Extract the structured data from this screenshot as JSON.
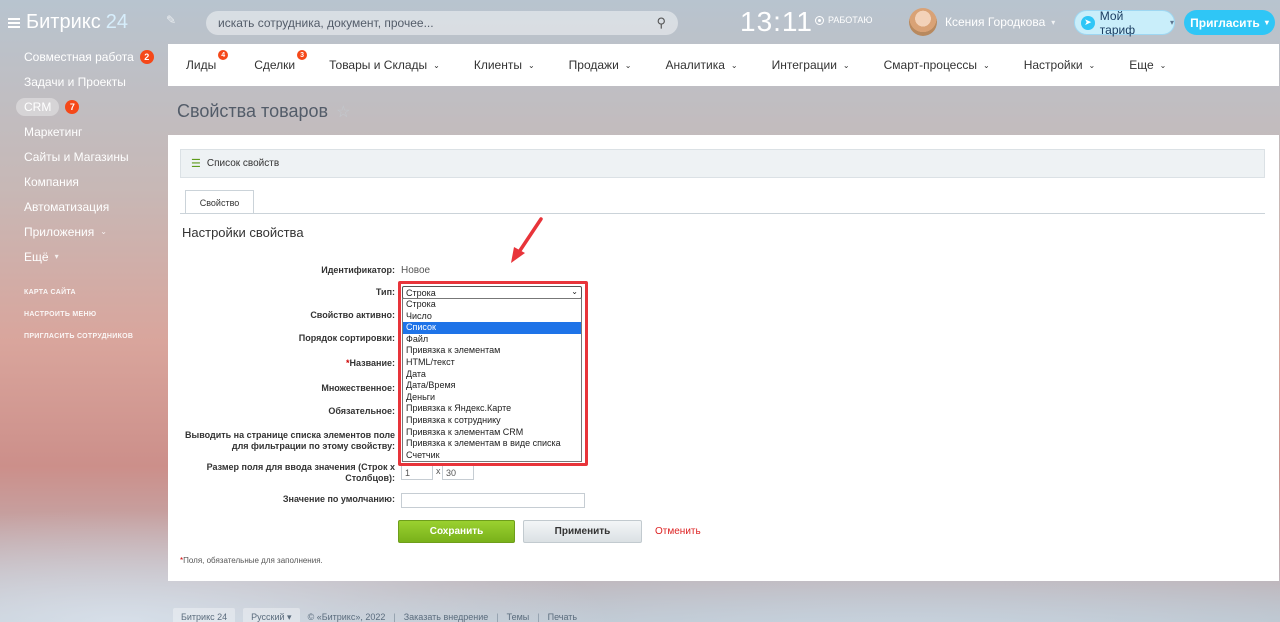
{
  "header": {
    "brand": "Битрикс",
    "brand_num": "24",
    "search_placeholder": "искать сотрудника, документ, прочее...",
    "clock": "13:11",
    "status": "РАБОТАЮ",
    "user_name": "Ксения Городкова",
    "tariff_label": "Мой тариф",
    "invite_label": "Пригласить"
  },
  "sidebar": {
    "items": [
      {
        "label": "Совместная работа",
        "counter": "2"
      },
      {
        "label": "Задачи и Проекты"
      },
      {
        "label": "CRM",
        "counter": "7"
      },
      {
        "label": "Маркетинг"
      },
      {
        "label": "Сайты и Магазины"
      },
      {
        "label": "Компания"
      },
      {
        "label": "Автоматизация"
      },
      {
        "label": "Приложения"
      },
      {
        "label": "Ещё"
      }
    ],
    "links": [
      "КАРТА САЙТА",
      "НАСТРОИТЬ МЕНЮ",
      "ПРИГЛАСИТЬ СОТРУДНИКОВ"
    ]
  },
  "topnav": {
    "items": [
      {
        "label": "Лиды",
        "counter": "4"
      },
      {
        "label": "Сделки",
        "counter": "3"
      },
      {
        "label": "Товары и Склады"
      },
      {
        "label": "Клиенты"
      },
      {
        "label": "Продажи"
      },
      {
        "label": "Аналитика"
      },
      {
        "label": "Интеграции"
      },
      {
        "label": "Смарт-процессы"
      },
      {
        "label": "Настройки"
      },
      {
        "label": "Еще"
      }
    ]
  },
  "page": {
    "title": "Свойства товаров",
    "list_link": "Список свойств",
    "tab": "Свойство",
    "section_title": "Настройки свойства"
  },
  "form": {
    "id_label": "Идентификатор:",
    "id_value": "Новое",
    "type_label": "Тип:",
    "type_selected": "Строка",
    "active_label": "Свойство активно:",
    "sort_label": "Порядок сортировки:",
    "name_label": "Название:",
    "multiple_label": "Множественное:",
    "required_label": "Обязательное:",
    "filter_label_1": "Выводить на странице списка элементов поле",
    "filter_label_2": "для фильтрации по этому свойству:",
    "size_label_1": "Размер поля для ввода значения (Строк х",
    "size_label_2": "Столбцов):",
    "size_rows": "1",
    "size_x": "x",
    "size_cols": "30",
    "default_label": "Значение по умолчанию:",
    "default_value": "",
    "type_options": [
      "Строка",
      "Число",
      "Список",
      "Файл",
      "Привязка к элементам",
      "HTML/текст",
      "Дата",
      "Дата/Время",
      "Деньги",
      "Привязка к Яндекс.Карте",
      "Привязка к сотруднику",
      "Привязка к элементам CRM",
      "Привязка к элементам в виде списка",
      "Счетчик"
    ],
    "highlighted_option": "Список"
  },
  "buttons": {
    "save": "Сохранить",
    "apply": "Применить",
    "cancel": "Отменить"
  },
  "footnote": "Поля, обязательные для заполнения.",
  "footer": {
    "brand": "Битрикс 24",
    "language": "Русский",
    "copyright": "© «Битрикс», 2022",
    "order": "Заказать внедрение",
    "themes": "Темы",
    "print": "Печать"
  },
  "colors": {
    "accent": "#2fc6f6",
    "counter": "#f54819",
    "highlight_box": "#e8343a",
    "selected_option": "#1e73e8",
    "save_button": "#8cc224"
  }
}
